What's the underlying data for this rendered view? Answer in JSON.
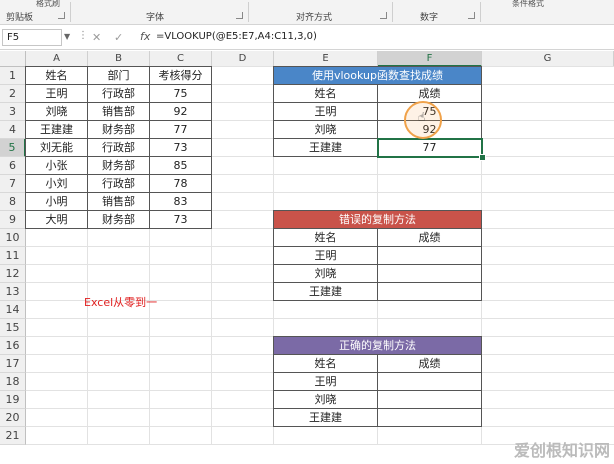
{
  "ribbon": {
    "groups": [
      "剪贴板",
      "字体",
      "对齐方式",
      "数字"
    ],
    "top_fragments": [
      "格式刷",
      "条件格式"
    ]
  },
  "formula_bar": {
    "name_box": "F5",
    "cancel_icon": "✕",
    "enter_icon": "✓",
    "fx_label": "fx",
    "formula": "=VLOOKUP(@E5:E7,A4:C11,3,0)"
  },
  "columns": [
    "A",
    "B",
    "C",
    "D",
    "E",
    "F",
    "G"
  ],
  "rows": [
    "1",
    "2",
    "3",
    "4",
    "5",
    "6",
    "7",
    "8",
    "9",
    "10",
    "11",
    "12",
    "13",
    "14",
    "15",
    "16",
    "17",
    "18",
    "19",
    "20",
    "21"
  ],
  "selection": {
    "column": "F",
    "row": "5"
  },
  "source_table": {
    "headers": [
      "姓名",
      "部门",
      "考核得分"
    ],
    "rows": [
      [
        "王明",
        "行政部",
        "75"
      ],
      [
        "刘晓",
        "销售部",
        "92"
      ],
      [
        "王建建",
        "财务部",
        "77"
      ],
      [
        "刘无能",
        "行政部",
        "73"
      ],
      [
        "小张",
        "财务部",
        "85"
      ],
      [
        "小刘",
        "行政部",
        "78"
      ],
      [
        "小明",
        "销售部",
        "83"
      ],
      [
        "大明",
        "财务部",
        "73"
      ]
    ]
  },
  "lookup_table": {
    "title": "使用vlookup函数查找成绩",
    "title_color": "#4a86c8",
    "headers": [
      "姓名",
      "成绩"
    ],
    "rows": [
      [
        "王明",
        "75"
      ],
      [
        "刘晓",
        "92"
      ],
      [
        "王建建",
        "77"
      ]
    ]
  },
  "wrong_table": {
    "title": "错误的复制方法",
    "title_color": "#c9534a",
    "headers": [
      "姓名",
      "成绩"
    ],
    "rows": [
      [
        "王明",
        ""
      ],
      [
        "刘晓",
        ""
      ],
      [
        "王建建",
        ""
      ]
    ]
  },
  "right_table": {
    "title": "正确的复制方法",
    "title_color": "#7b6aa6",
    "headers": [
      "姓名",
      "成绩"
    ],
    "rows": [
      [
        "王明",
        ""
      ],
      [
        "刘晓",
        ""
      ],
      [
        "王建建",
        ""
      ]
    ]
  },
  "annotation": "Excel从零到一",
  "watermark": "爱创根知识网",
  "accent_color": "#217346"
}
